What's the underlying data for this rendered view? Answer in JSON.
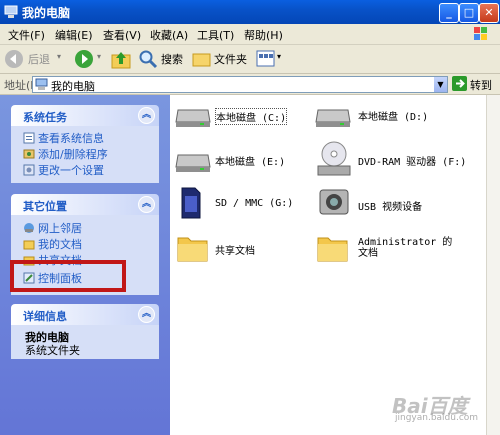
{
  "window": {
    "title": "我的电脑"
  },
  "menu": [
    "文件(F)",
    "编辑(E)",
    "查看(V)",
    "收藏(A)",
    "工具(T)",
    "帮助(H)"
  ],
  "toolbar": {
    "back": "后退",
    "search": "搜索",
    "folders": "文件夹"
  },
  "address": {
    "label": "地址(D)",
    "value": "我的电脑",
    "go": "转到"
  },
  "left": {
    "system_tasks": {
      "title": "系统任务",
      "items": [
        "查看系统信息",
        "添加/删除程序",
        "更改一个设置"
      ]
    },
    "other_places": {
      "title": "其它位置",
      "items": [
        "网上邻居",
        "我的文档",
        "共享文档",
        "控制面板"
      ]
    },
    "details": {
      "title": "详细信息",
      "name": "我的电脑",
      "type": "系统文件夹"
    }
  },
  "items": [
    {
      "label": "本地磁盘 (C:)",
      "icon": "drive-icon"
    },
    {
      "label": "本地磁盘 (D:)",
      "icon": "drive-icon"
    },
    {
      "label": "本地磁盘 (E:)",
      "icon": "drive-icon"
    },
    {
      "label": "DVD-RAM 驱动器 (F:)",
      "icon": "dvd-icon"
    },
    {
      "label": "SD / MMC (G:)",
      "icon": "sd-card-icon"
    },
    {
      "label": "USB 视频设备",
      "icon": "camera-icon"
    },
    {
      "label": "共享文档",
      "icon": "folder-icon"
    },
    {
      "label": "Administrator 的文档",
      "icon": "folder-icon"
    }
  ],
  "watermark": {
    "brand": "Bai百度",
    "sub": "jingyan.baidu.com"
  }
}
